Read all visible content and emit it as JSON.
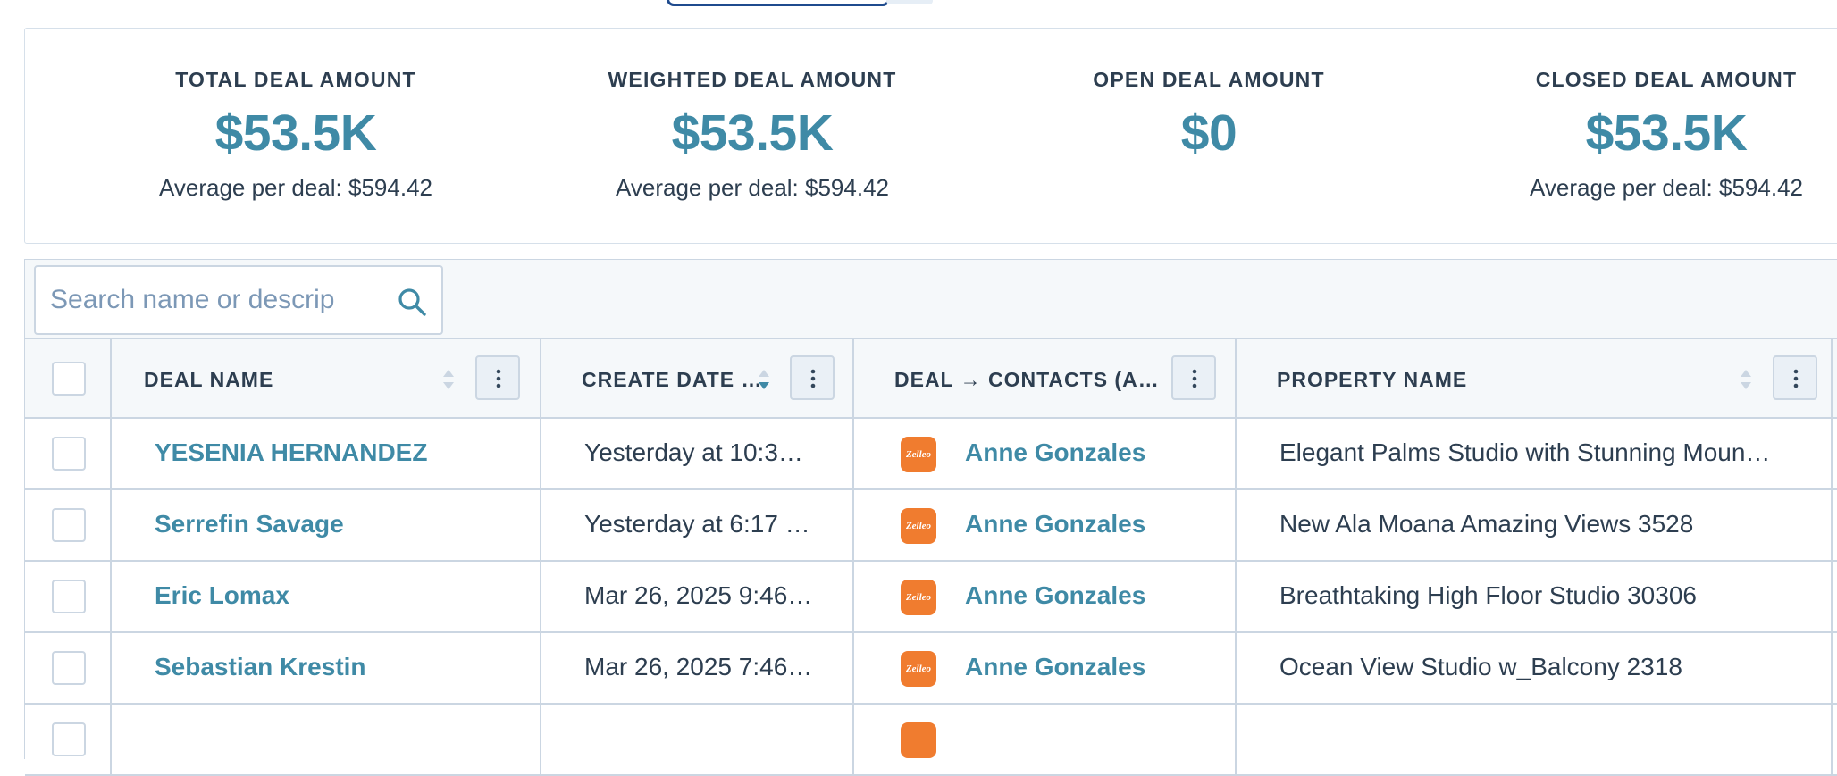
{
  "summary": {
    "stats": [
      {
        "label": "TOTAL DEAL AMOUNT",
        "value": "$53.5K",
        "avg": "Average per deal: $594.42"
      },
      {
        "label": "WEIGHTED DEAL AMOUNT",
        "value": "$53.5K",
        "avg": "Average per deal: $594.42"
      },
      {
        "label": "OPEN DEAL AMOUNT",
        "value": "$0",
        "avg": ""
      },
      {
        "label": "CLOSED DEAL AMOUNT",
        "value": "$53.5K",
        "avg": "Average per deal: $594.42"
      }
    ]
  },
  "search": {
    "placeholder": "Search name or descrip"
  },
  "table": {
    "columns": [
      "DEAL NAME",
      "CREATE DATE …",
      "DEAL → CONTACTS (A…",
      "PROPERTY NAME"
    ],
    "rows": [
      {
        "deal": "YESENIA HERNANDEZ",
        "created": "Yesterday at 10:3…",
        "logo": "Zelleo",
        "contact": "Anne Gonzales",
        "property": "Elegant Palms Studio with Stunning Moun…"
      },
      {
        "deal": "Serrefin Savage",
        "created": "Yesterday at 6:17 …",
        "logo": "Zelleo",
        "contact": "Anne Gonzales",
        "property": "New Ala Moana Amazing Views 3528"
      },
      {
        "deal": "Eric Lomax",
        "created": "Mar 26, 2025 9:46…",
        "logo": "Zelleo",
        "contact": "Anne Gonzales",
        "property": "Breathtaking High Floor Studio 30306"
      },
      {
        "deal": "Sebastian Krestin",
        "created": "Mar 26, 2025 7:46…",
        "logo": "Zelleo",
        "contact": "Anne Gonzales",
        "property": "Ocean View Studio w_Balcony 2318"
      }
    ]
  },
  "colors": {
    "accent": "#3f8aa6",
    "logo_bg": "#f07c2f",
    "border": "#cbd6e2"
  }
}
